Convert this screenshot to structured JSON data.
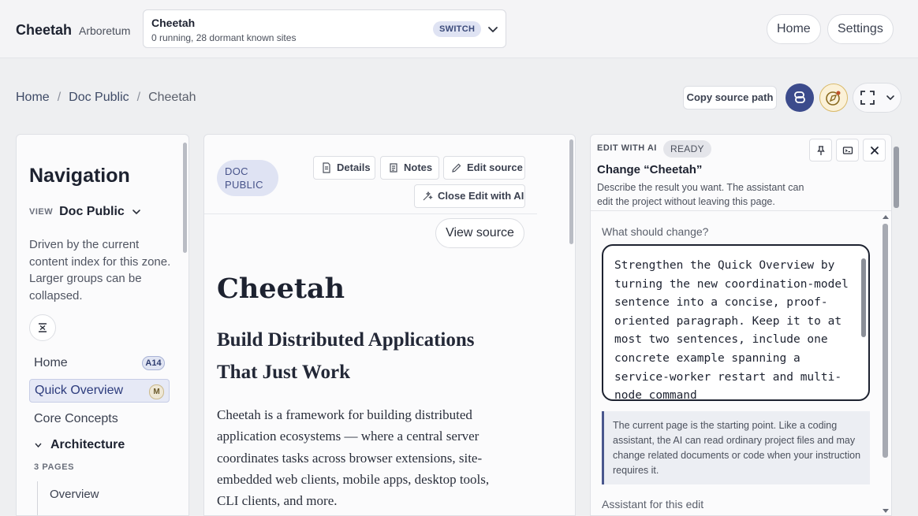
{
  "app": {
    "name": "Cheetah",
    "subtitle": "Arboretum"
  },
  "site_switcher": {
    "title": "Cheetah",
    "status": "0 running, 28 dormant known sites",
    "switch_label": "SWITCH"
  },
  "topnav": {
    "home": "Home",
    "settings": "Settings"
  },
  "breadcrumb": {
    "items": [
      "Home",
      "Doc Public",
      "Cheetah"
    ],
    "separator": "/"
  },
  "toolbar": {
    "copy_source_path": "Copy source path"
  },
  "navigation": {
    "heading": "Navigation",
    "view_label": "VIEW",
    "view_value": "Doc Public",
    "description": "Driven by the current content index for this zone. Larger groups can be collapsed.",
    "items": [
      {
        "label": "Home",
        "badge": "A14"
      },
      {
        "label": "Quick Overview",
        "badge": "M"
      },
      {
        "label": "Core Concepts",
        "badge": ""
      }
    ],
    "section": {
      "label": "Architecture",
      "meta": "3 PAGES",
      "children": [
        "Overview"
      ]
    }
  },
  "document": {
    "chip": "DOC PUBLIC",
    "tabs": {
      "details": "Details",
      "notes": "Notes",
      "edit_source": "Edit source",
      "close_edit": "Close Edit with AI"
    },
    "view_source": "View source",
    "title": "Cheetah",
    "subtitle": "Build Distributed Applications That Just Work",
    "body": "Cheetah is a framework for building distributed application ecosystems — where a central server coordinates tasks across browser extensions, site-embedded web clients, mobile apps, desktop tools, CLI clients, and more."
  },
  "edit_panel": {
    "kicker": "EDIT WITH AI",
    "status": "READY",
    "title": "Change “Cheetah”",
    "description": "Describe the result you want. The assistant can edit the project without leaving this page.",
    "field_label": "What should change?",
    "prompt_value": "Strengthen the Quick Overview by turning the new coordination-model sentence into a concise, proof-oriented paragraph. Keep it to at most two sentences, include one concrete example spanning a service-worker restart and multi-node command",
    "note": "The current page is the starting point. Like a coding assistant, the AI can read ordinary project files and may change related documents or code when your instruction requires it.",
    "assistant_label": "Assistant for this edit"
  },
  "colors": {
    "accent": "#3c4b8c",
    "chip_bg": "#dfe3f3",
    "active_nav_bg": "#e6e9f6",
    "gold": "#d9b968"
  },
  "icons": [
    "chevron-down-icon",
    "link-icon",
    "compass-icon",
    "expand-icon",
    "collapse-all-icon",
    "document-icon",
    "notes-icon",
    "pencil-icon",
    "ai-edit-icon",
    "pin-icon",
    "terminal-icon",
    "close-icon"
  ]
}
